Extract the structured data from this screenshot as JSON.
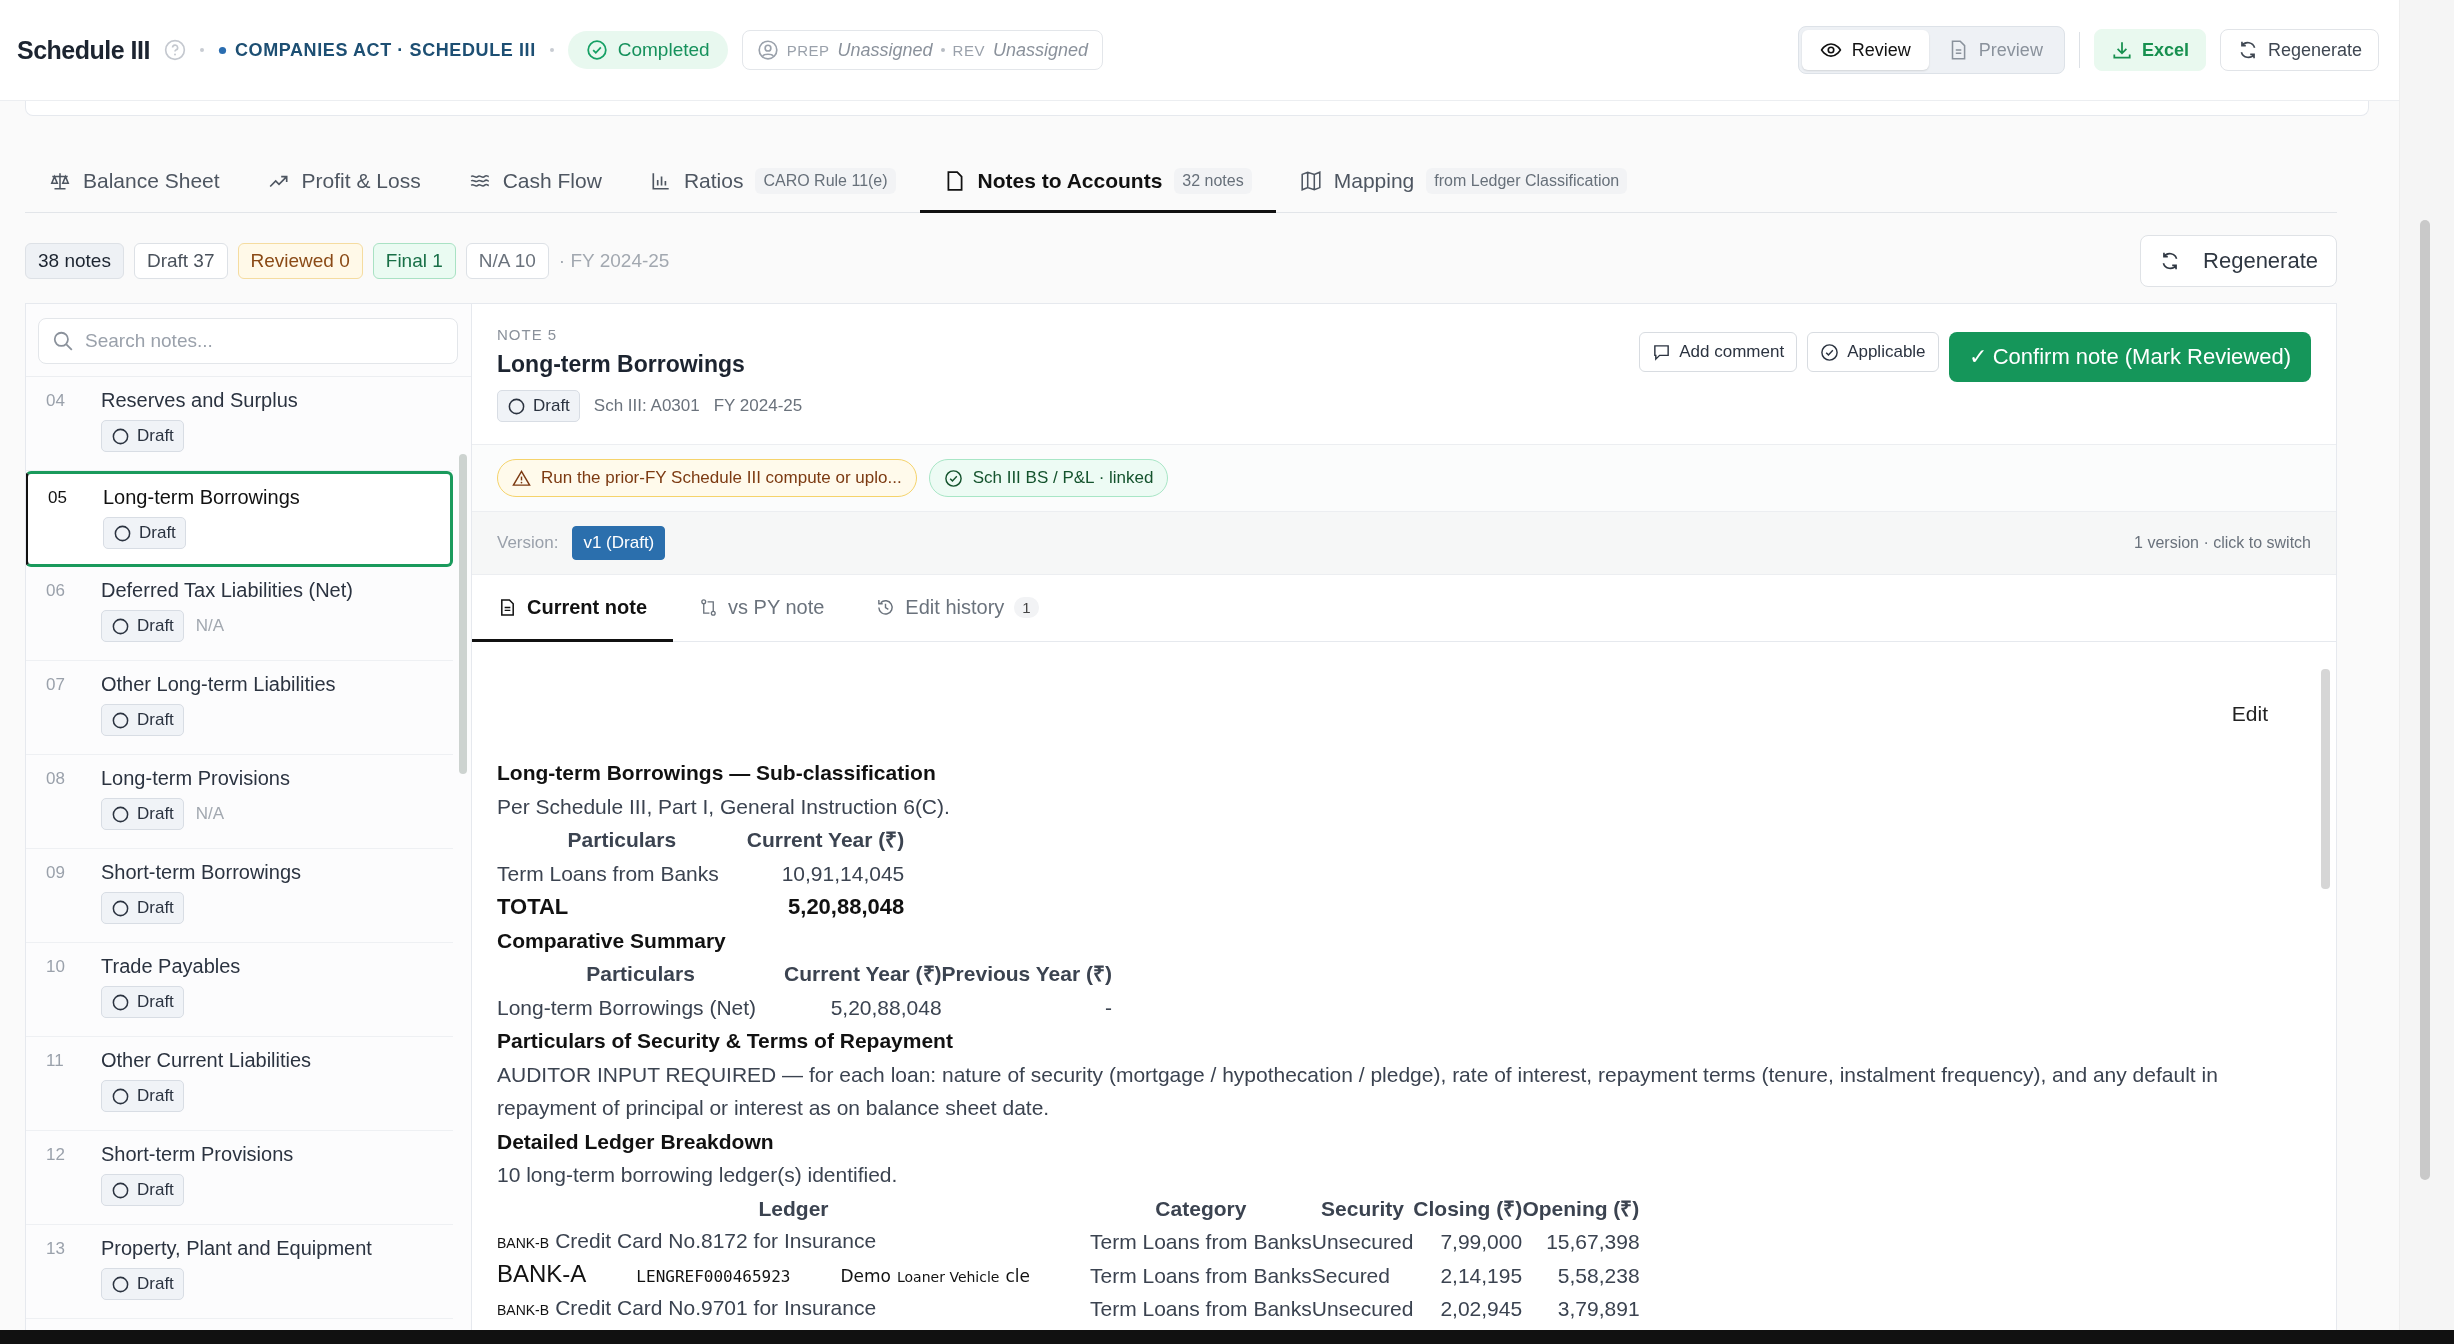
{
  "header": {
    "title": "Schedule III",
    "framework": "COMPANIES ACT · SCHEDULE III",
    "status": "Completed",
    "prep_label": "PREP",
    "prep_value": "Unassigned",
    "rev_label": "REV",
    "rev_value": "Unassigned",
    "view_toggle": [
      {
        "label": "Review",
        "kind": "eye",
        "selected": true
      },
      {
        "label": "Preview",
        "kind": "doc",
        "selected": false
      }
    ],
    "actions": [
      {
        "label": "Excel",
        "kind": "export"
      },
      {
        "label": "Regenerate",
        "kind": "regenerate"
      }
    ]
  },
  "tabs": [
    {
      "label": "Balance Sheet",
      "kind": "scale",
      "selected": false
    },
    {
      "label": "Profit & Loss",
      "kind": "trend",
      "selected": false
    },
    {
      "label": "Cash Flow",
      "kind": "waves",
      "selected": false
    },
    {
      "label": "Ratios",
      "kind": "bars",
      "badge": "CARO Rule 11(e)",
      "selected": false
    },
    {
      "label": "Notes to Accounts",
      "kind": "file",
      "badge": "32 notes",
      "selected": true
    },
    {
      "label": "Mapping",
      "kind": "map",
      "badge": "from Ledger Classification",
      "selected": false
    }
  ],
  "summary": {
    "chips": [
      {
        "label": "38 notes",
        "kind": "total"
      },
      {
        "label": "Draft 37",
        "kind": "draft"
      },
      {
        "label": "Reviewed 0",
        "kind": "reviewed"
      },
      {
        "label": "Final 1",
        "kind": "final"
      },
      {
        "label": "N/A 10",
        "kind": "na"
      }
    ],
    "period": "· FY 2024-25",
    "regenerate": "Regenerate"
  },
  "sidebar": {
    "search_placeholder": "Search notes...",
    "items": [
      {
        "number": "04",
        "title": "Reserves and Surplus",
        "status": "Draft",
        "selected": false
      },
      {
        "number": "05",
        "title": "Long-term Borrowings",
        "status": "Draft",
        "selected": true
      },
      {
        "number": "06",
        "title": "Deferred Tax Liabilities (Net)",
        "status": "Draft",
        "tag": "N/A",
        "selected": false
      },
      {
        "number": "07",
        "title": "Other Long-term Liabilities",
        "status": "Draft",
        "selected": false
      },
      {
        "number": "08",
        "title": "Long-term Provisions",
        "status": "Draft",
        "tag": "N/A",
        "selected": false
      },
      {
        "number": "09",
        "title": "Short-term Borrowings",
        "status": "Draft",
        "selected": false
      },
      {
        "number": "10",
        "title": "Trade Payables",
        "status": "Draft",
        "selected": false
      },
      {
        "number": "11",
        "title": "Other Current Liabilities",
        "status": "Draft",
        "selected": false
      },
      {
        "number": "12",
        "title": "Short-term Provisions",
        "status": "Draft",
        "selected": false
      },
      {
        "number": "13",
        "title": "Property, Plant and Equipment",
        "status": "Draft",
        "selected": false
      }
    ]
  },
  "note": {
    "label": "NOTE 5",
    "title": "Long-term Borrowings",
    "status": "Draft",
    "code": "Sch III: A0301",
    "period": "FY 2024-25",
    "actions": [
      {
        "label": "Add comment",
        "kind": "comment"
      },
      {
        "label": "Applicable",
        "kind": "applicable"
      },
      {
        "label": "✓ Confirm note (Mark Reviewed)",
        "kind": "primary"
      }
    ],
    "alerts": [
      {
        "text": "Run the prior-FY Schedule III compute or uplo...",
        "kind": "warning"
      },
      {
        "text": "Sch III BS / P&L · linked",
        "kind": "success"
      }
    ],
    "version_label": "Version:",
    "versions": [
      {
        "label": "v1 (Draft)",
        "selected": true
      }
    ],
    "version_hint": "1 version · click to switch",
    "tabs": [
      {
        "label": "Current note",
        "kind": "doc",
        "selected": true
      },
      {
        "label": "vs PY note",
        "kind": "compare",
        "selected": false
      },
      {
        "label": "Edit history",
        "kind": "history",
        "count": "1",
        "selected": false
      }
    ],
    "edit": "Edit",
    "body": [
      {
        "kind": "heading",
        "text": "Long-term Borrowings — Sub-classification"
      },
      {
        "kind": "para",
        "text": "Per Schedule III, Part I, General Instruction 6(C)."
      },
      {
        "kind": "table",
        "columns": [
          "Particulars",
          "Current Year (₹)"
        ],
        "rows": [
          {
            "cells": [
              "Term Loans from Banks",
              "10,91,14,045"
            ],
            "bold": false
          },
          {
            "cells": [
              "TOTAL",
              "5,20,88,048"
            ],
            "bold": true
          }
        ]
      },
      {
        "kind": "heading",
        "text": "Comparative Summary"
      },
      {
        "kind": "table",
        "columns": [
          "Particulars",
          "Current Year (₹)",
          "Previous Year (₹)"
        ],
        "rows": [
          {
            "cells": [
              "Long-term Borrowings (Net)",
              "5,20,88,048",
              "-"
            ],
            "bold": false
          }
        ]
      },
      {
        "kind": "heading",
        "text": "Particulars of Security & Terms of Repayment"
      },
      {
        "kind": "para",
        "text": "AUDITOR INPUT REQUIRED — for each loan: nature of security (mortgage / hypothecation / pledge), rate of interest, repayment terms (tenure, instalment frequency), and any default in repayment of principal or interest as on balance sheet date."
      },
      {
        "kind": "heading",
        "text": "Detailed Ledger Breakdown"
      },
      {
        "kind": "para",
        "text": "10 long-term borrowing ledger(s) identified."
      },
      {
        "kind": "ledger",
        "columns": [
          "Ledger",
          "Category",
          "Security",
          "Closing (₹)",
          "Opening (₹)"
        ],
        "rows": [
          {
            "ledger": [
              {
                "text": "BANK-B",
                "kind": "tag"
              },
              {
                "text": "Credit Card No.8172 for Insurance",
                "kind": "text"
              }
            ],
            "category": "Term Loans from Banks",
            "security": "Unsecured",
            "closing": "7,99,000",
            "opening": "15,67,398"
          },
          {
            "ledger": [
              {
                "text": "BANK-A",
                "kind": "large"
              },
              {
                "text": "LENGREF000465923",
                "kind": "mono"
              },
              {
                "text": "Demo",
                "kind": "monobold"
              },
              {
                "text": "Loaner Vehicle",
                "kind": "small"
              },
              {
                "text": "cle",
                "kind": "monobold"
              }
            ],
            "category": "Term Loans from Banks",
            "security": "Secured",
            "closing": "2,14,195",
            "opening": "5,58,238"
          },
          {
            "ledger": [
              {
                "text": "BANK-B",
                "kind": "tag"
              },
              {
                "text": "Credit Card No.9701 for Insurance",
                "kind": "text"
              }
            ],
            "category": "Term Loans from Banks",
            "security": "Unsecured",
            "closing": "2,02,945",
            "opening": "3,79,891"
          }
        ]
      }
    ]
  }
}
